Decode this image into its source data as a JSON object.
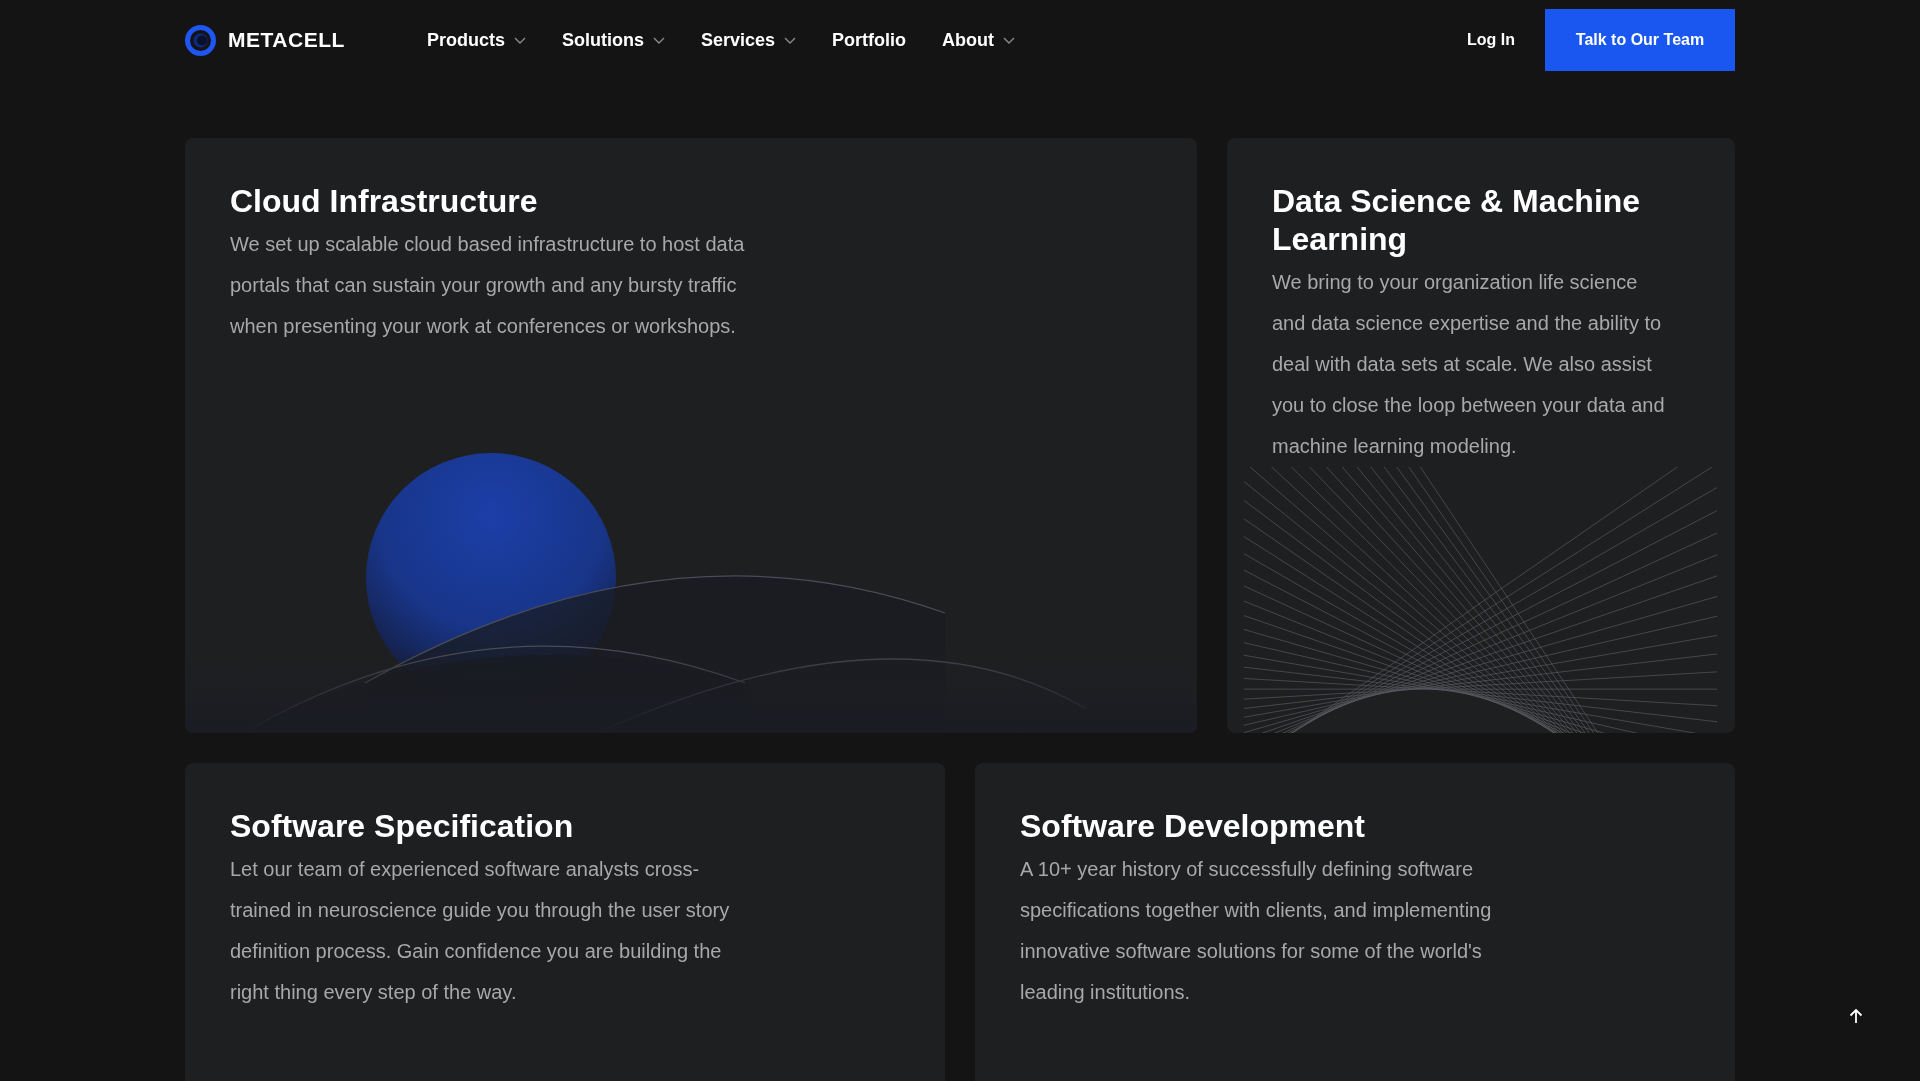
{
  "brand": "METACELL",
  "nav": [
    {
      "label": "Products",
      "has_dropdown": true
    },
    {
      "label": "Solutions",
      "has_dropdown": true
    },
    {
      "label": "Services",
      "has_dropdown": true
    },
    {
      "label": "Portfolio",
      "has_dropdown": false
    },
    {
      "label": "About",
      "has_dropdown": true
    }
  ],
  "login": "Log In",
  "cta": "Talk to Our Team",
  "cards": [
    {
      "title": "Cloud Infrastructure",
      "body": "We set up scalable cloud based infrastructure to host data portals that can sustain your growth and any bursty traffic when presenting your work at conferences or workshops.",
      "kind": "spheres"
    },
    {
      "title": "Data Science & Machine Learning",
      "body": "We bring to your organization life science and data science expertise and the ability to deal with data sets at scale. We also assist you to close the loop between your data and machine learning modeling.",
      "kind": "lines"
    },
    {
      "title": "Software Specification",
      "body": "Let our team of experienced software analysts cross-trained in neuroscience guide you through the user story definition process. Gain confidence you are building the right thing every step of the way.",
      "kind": "plain"
    },
    {
      "title": "Software Development",
      "body": "A 10+ year history of successfully defining software specifications together with clients, and implementing innovative software solutions for some of the world's leading institutions.",
      "kind": "plain"
    }
  ]
}
